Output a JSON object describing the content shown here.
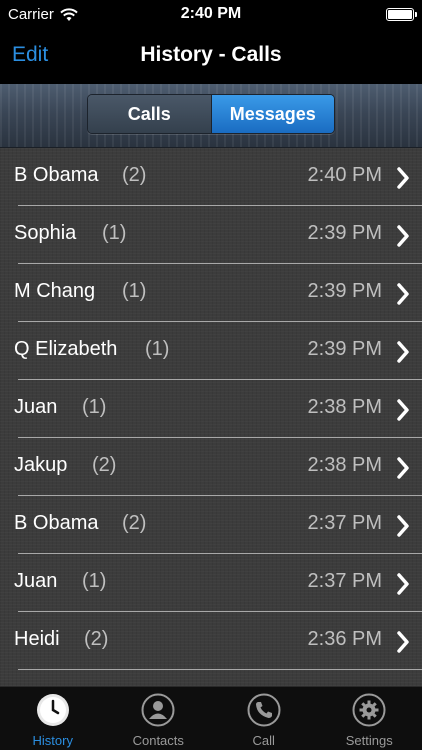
{
  "status_bar": {
    "carrier": "Carrier",
    "time": "2:40 PM"
  },
  "nav": {
    "edit_label": "Edit",
    "title": "History - Calls"
  },
  "segments": {
    "calls_label": "Calls",
    "messages_label": "Messages",
    "selected": "Messages"
  },
  "rows": [
    {
      "name": "B Obama",
      "count": "(2)",
      "time": "2:40 PM"
    },
    {
      "name": "Sophia",
      "count": "(1)",
      "time": "2:39 PM"
    },
    {
      "name": "M Chang",
      "count": "(1)",
      "time": "2:39 PM"
    },
    {
      "name": "Q Elizabeth",
      "count": "(1)",
      "time": "2:39 PM"
    },
    {
      "name": "Juan",
      "count": "(1)",
      "time": "2:38 PM"
    },
    {
      "name": "Jakup",
      "count": "(2)",
      "time": "2:38 PM"
    },
    {
      "name": "B Obama",
      "count": "(2)",
      "time": "2:37 PM"
    },
    {
      "name": "Juan",
      "count": "(1)",
      "time": "2:37 PM"
    },
    {
      "name": "Heidi",
      "count": "(2)",
      "time": "2:36 PM"
    }
  ],
  "tabs": [
    {
      "label": "History",
      "icon": "clock-icon",
      "active": true
    },
    {
      "label": "Contacts",
      "icon": "person-icon",
      "active": false
    },
    {
      "label": "Call",
      "icon": "phone-icon",
      "active": false
    },
    {
      "label": "Settings",
      "icon": "gear-icon",
      "active": false
    }
  ],
  "colors": {
    "accent": "#2b8ee0",
    "segment_selected": "#1a6cc2",
    "list_bg": "#3c3c3c"
  }
}
